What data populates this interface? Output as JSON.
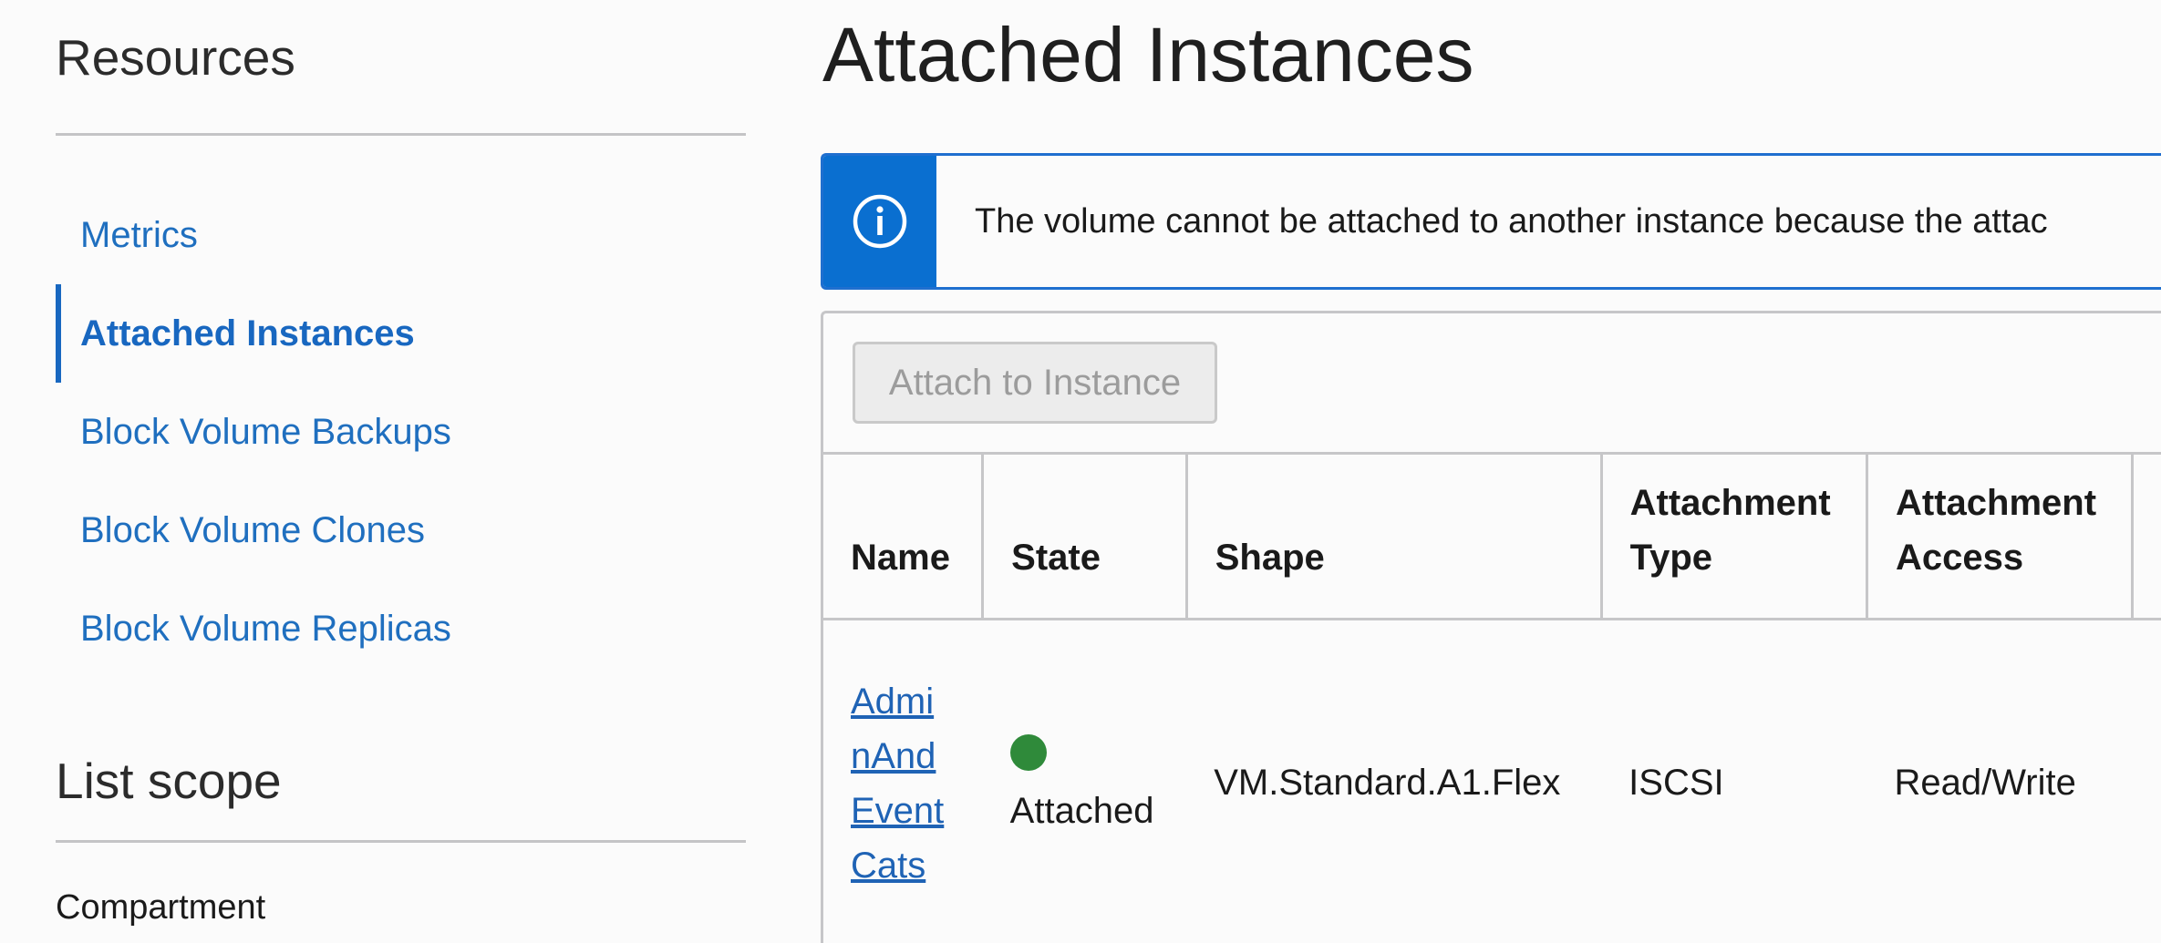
{
  "sidebar": {
    "resources_title": "Resources",
    "items": [
      {
        "label": "Metrics",
        "active": false
      },
      {
        "label": "Attached Instances",
        "active": true
      },
      {
        "label": "Block Volume Backups",
        "active": false
      },
      {
        "label": "Block Volume Clones",
        "active": false
      },
      {
        "label": "Block Volume Replicas",
        "active": false
      }
    ],
    "scope_title": "List scope",
    "compartment_label": "Compartment"
  },
  "main": {
    "title": "Attached Instances",
    "info_banner": {
      "icon": "info-icon",
      "text": "The volume cannot be attached to another instance because the attac"
    },
    "toolbar": {
      "attach_button_label": "Attach to Instance",
      "attach_button_disabled": true
    },
    "table": {
      "columns": [
        "Name",
        "State",
        "Shape",
        "Attachment Type",
        "Attachment Access"
      ],
      "rows": [
        {
          "name": "AdminAndEventCats",
          "state": "Attached",
          "state_icon": "status-dot-icon",
          "shape": "VM.Standard.A1.Flex",
          "attachment_type": "ISCSI",
          "attachment_access": "Read/Write"
        }
      ]
    }
  },
  "colors": {
    "link": "#1f6fbf",
    "accent": "#0a6fd0",
    "status_attached": "#2f8a3a",
    "divider": "#c4c4c6"
  }
}
